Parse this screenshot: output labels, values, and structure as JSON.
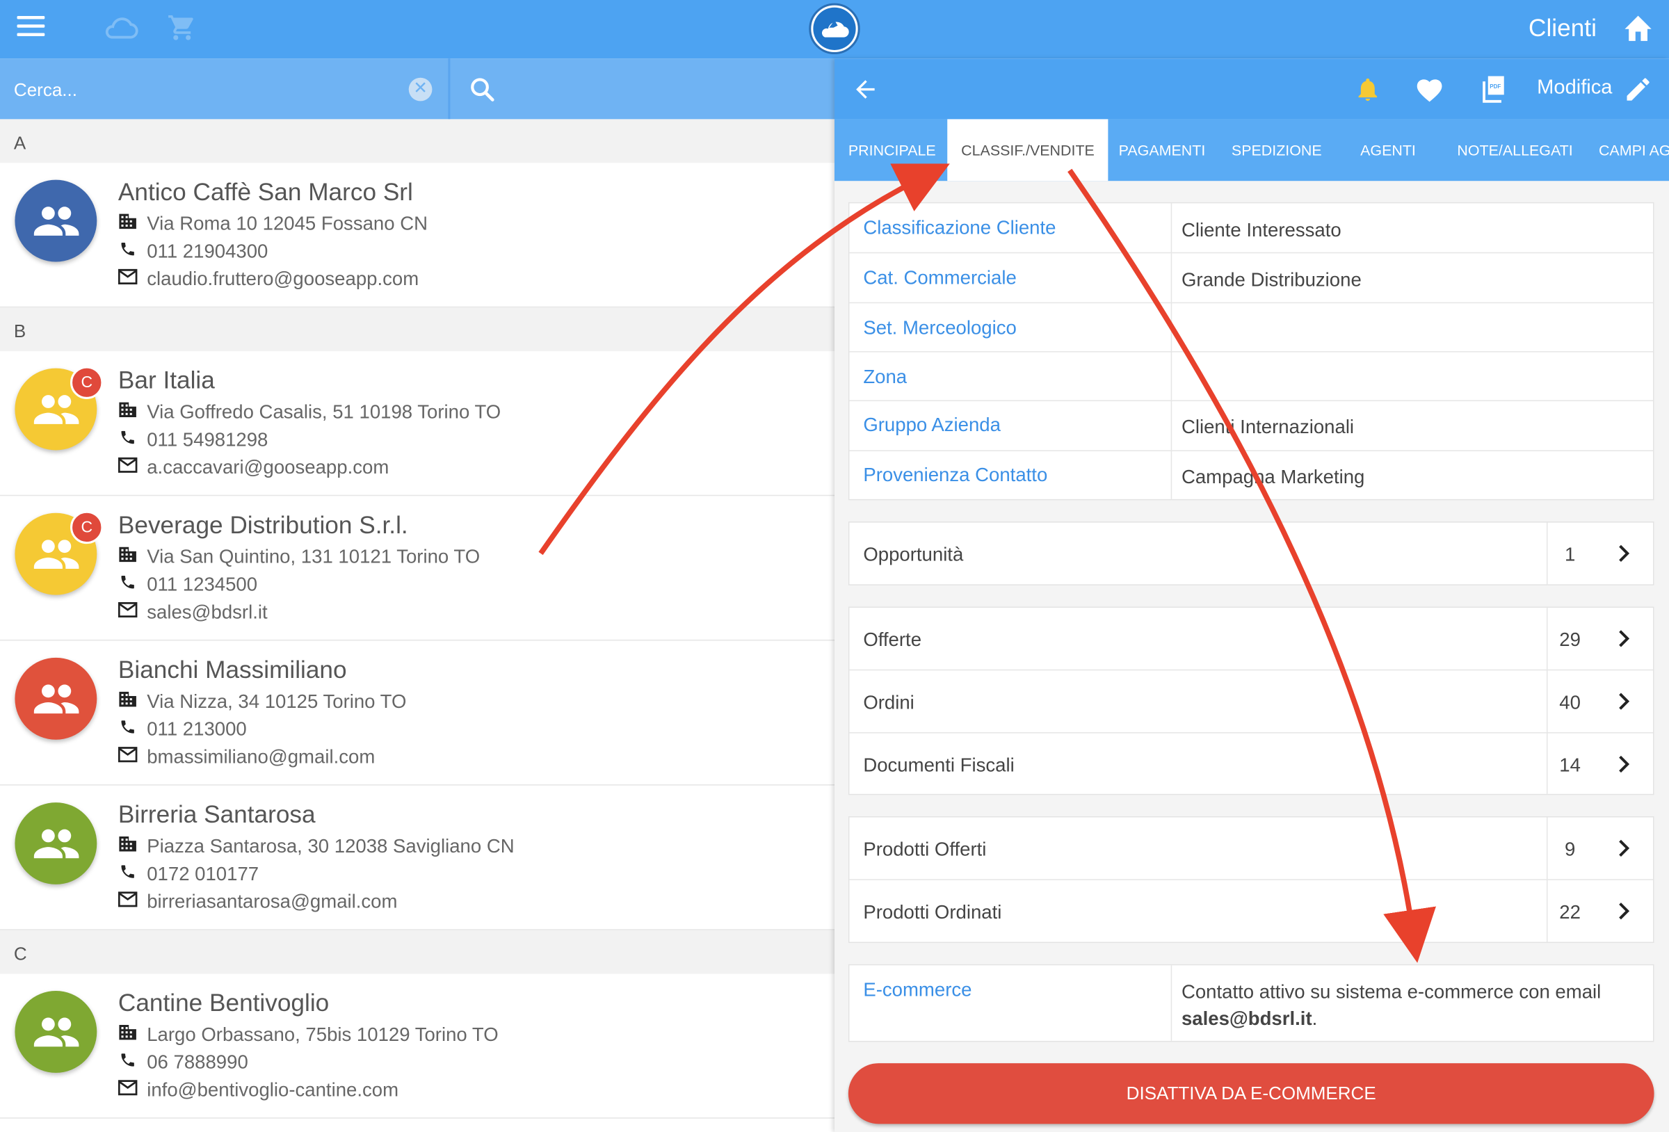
{
  "app": {
    "title": "Clienti"
  },
  "search": {
    "placeholder": "Cerca..."
  },
  "sections": [
    "A",
    "B",
    "C"
  ],
  "clients": [
    {
      "name": "Antico Caffè San Marco Srl",
      "address": "Via Roma 10 12045 Fossano CN",
      "phone": "011 21904300",
      "email": "claudio.fruttero@gooseapp.com",
      "color": "#3f68ad",
      "badge": ""
    },
    {
      "name": "Bar Italia",
      "address": "Via Goffredo Casalis, 51 10198 Torino TO",
      "phone": "011 54981298",
      "email": "a.caccavari@gooseapp.com",
      "color": "#f5c934",
      "badge": "C"
    },
    {
      "name": "Beverage Distribution S.r.l.",
      "address": "Via San Quintino, 131 10121 Torino TO",
      "phone": "011 1234500",
      "email": "sales@bdsrl.it",
      "color": "#f5c934",
      "badge": "C"
    },
    {
      "name": "Bianchi Massimiliano",
      "address": "Via Nizza, 34 10125 Torino TO",
      "phone": "011 213000",
      "email": "bmassimiliano@gmail.com",
      "color": "#e0523c",
      "badge": ""
    },
    {
      "name": "Birreria Santarosa",
      "address": "Piazza Santarosa, 30 12038 Savigliano CN",
      "phone": "0172 010177",
      "email": "birreriasantarosa@gmail.com",
      "color": "#7fa832",
      "badge": ""
    },
    {
      "name": "Cantine Bentivoglio",
      "address": "Largo Orbassano, 75bis 10129 Torino TO",
      "phone": "06 7888990",
      "email": "info@bentivoglio-cantine.com",
      "color": "#7fa832",
      "badge": ""
    }
  ],
  "detail": {
    "edit_label": "Modifica",
    "tabs": [
      "PRINCIPALE",
      "CLASSIF./VENDITE",
      "PAGAMENTI",
      "SPEDIZIONE",
      "AGENTI",
      "NOTE/ALLEGATI",
      "CAMPI AG"
    ],
    "active_tab": "CLASSIF./VENDITE",
    "classification": [
      {
        "label": "Classificazione Cliente",
        "value": "Cliente Interessato"
      },
      {
        "label": "Cat. Commerciale",
        "value": "Grande Distribuzione"
      },
      {
        "label": "Set. Merceologico",
        "value": ""
      },
      {
        "label": "Zona",
        "value": ""
      },
      {
        "label": "Gruppo Azienda",
        "value": "Clienti Internazionali"
      },
      {
        "label": "Provenienza Contatto",
        "value": "Campagna Marketing"
      }
    ],
    "counts_1": [
      {
        "label": "Opportunità",
        "value": "1"
      }
    ],
    "counts_2": [
      {
        "label": "Offerte",
        "value": "29"
      },
      {
        "label": "Ordini",
        "value": "40"
      },
      {
        "label": "Documenti Fiscali",
        "value": "14"
      }
    ],
    "counts_3": [
      {
        "label": "Prodotti Offerti",
        "value": "9"
      },
      {
        "label": "Prodotti Ordinati",
        "value": "22"
      }
    ],
    "ecommerce": {
      "label": "E-commerce",
      "text": "Contatto attivo su sistema e-commerce con email",
      "email": "sales@bdsrl.it",
      "suffix": "."
    },
    "disable_button": "DISATTIVA DA E-COMMERCE"
  },
  "colors": {
    "primary": "#4da3f2",
    "accent_red": "#e04d3f",
    "annotation_arrow": "#e8412c"
  }
}
